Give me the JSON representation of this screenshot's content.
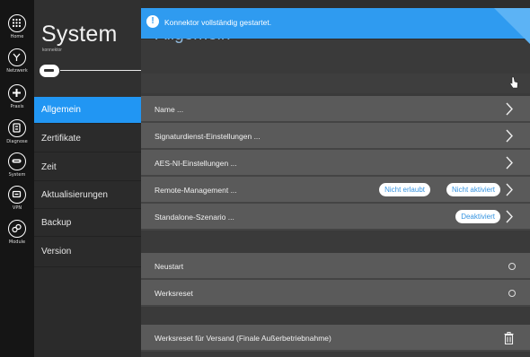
{
  "rail": {
    "items": [
      {
        "label": "Home",
        "icon": "grid-icon"
      },
      {
        "label": "Netzwerk",
        "icon": "network-icon"
      },
      {
        "label": "Praxis",
        "icon": "praxis-icon"
      },
      {
        "label": "Diagnose",
        "icon": "diagnose-icon"
      },
      {
        "label": "System",
        "icon": "system-icon"
      },
      {
        "label": "VPN",
        "icon": "vpn-icon"
      },
      {
        "label": "Module",
        "icon": "module-icon"
      }
    ]
  },
  "nav": {
    "title": "System",
    "subtitle": "konnektor",
    "items": [
      {
        "label": "Allgemein",
        "active": true
      },
      {
        "label": "Zertifikate"
      },
      {
        "label": "Zeit"
      },
      {
        "label": "Aktualisierungen"
      },
      {
        "label": "Backup"
      },
      {
        "label": "Version"
      }
    ]
  },
  "main": {
    "title": "Allgemein",
    "notice": "Konnektor vollständig gestartet.",
    "settings": [
      {
        "label": "Name ..."
      },
      {
        "label": "Signaturdienst-Einstellungen ..."
      },
      {
        "label": "AES-NI-Einstellungen ..."
      },
      {
        "label": "Remote-Management ...",
        "badges": [
          "Nicht erlaubt",
          "Nicht aktiviert"
        ]
      },
      {
        "label": "Standalone-Szenario ...",
        "badges": [
          "Deaktiviert"
        ]
      }
    ],
    "actions": [
      {
        "label": "Neustart"
      },
      {
        "label": "Werksreset"
      }
    ],
    "danger": {
      "label": "Werksreset für Versand (Finale Außerbetriebnahme)"
    }
  },
  "colors": {
    "accent": "#2196f3",
    "notice": "#2f9bf0",
    "row": "#5a5a5a",
    "rail": "#151515"
  }
}
